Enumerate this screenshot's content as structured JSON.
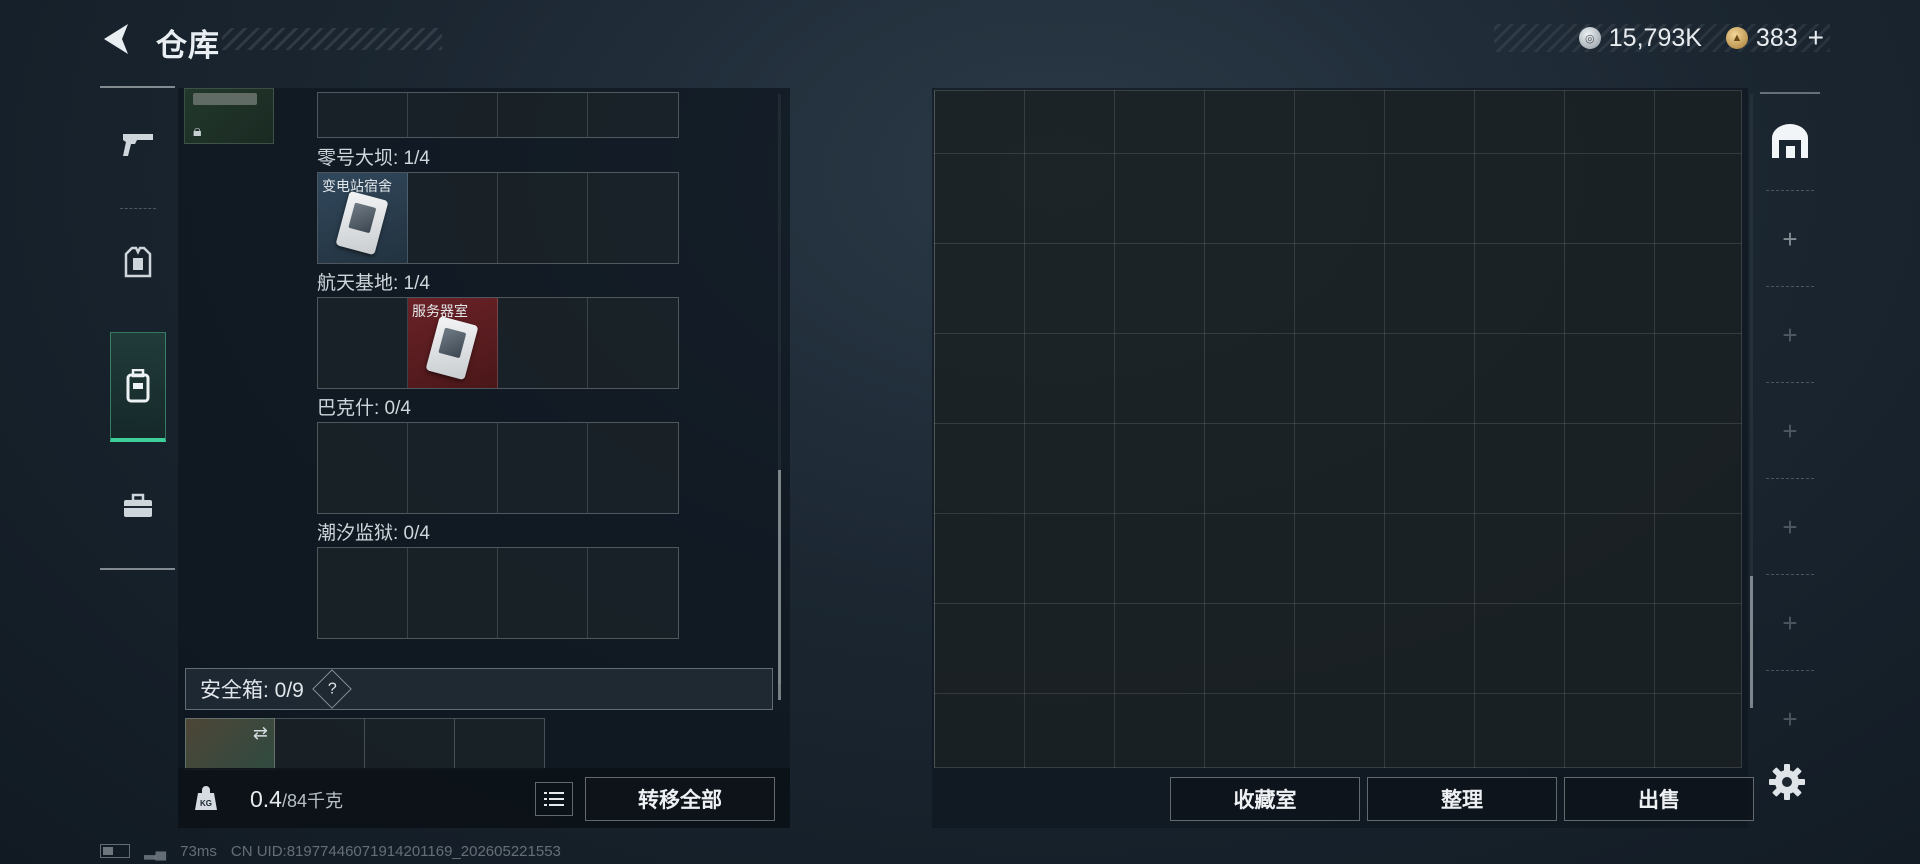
{
  "header": {
    "title": "仓库",
    "currency_silver": "15,793K",
    "currency_gold": "383",
    "add_label": "+"
  },
  "left_nav": {
    "items": [
      {
        "id": "weapons",
        "icon": "pistol-icon"
      },
      {
        "id": "armor",
        "icon": "vest-icon"
      },
      {
        "id": "backpack",
        "icon": "backpack-icon",
        "active": true
      },
      {
        "id": "toolbox",
        "icon": "toolbox-icon"
      }
    ]
  },
  "key_sections": [
    {
      "label": "零号大坝: 1/4",
      "slots": [
        {
          "item": "变电站宿舍",
          "color": "blue"
        },
        null,
        null,
        null
      ]
    },
    {
      "label": "航天基地: 1/4",
      "slots": [
        null,
        {
          "item": "服务器室",
          "color": "red"
        },
        null,
        null
      ]
    },
    {
      "label": "巴克什: 0/4",
      "slots": [
        null,
        null,
        null,
        null
      ]
    },
    {
      "label": "潮汐监狱: 0/4",
      "slots": [
        null,
        null,
        null,
        null
      ]
    }
  ],
  "safebox": {
    "label": "安全箱: 0/9",
    "help": "?"
  },
  "carry": {
    "weight_current": "0.4",
    "weight_max": "/84千克",
    "weight_icon_label": "KG"
  },
  "buttons": {
    "transfer_all": "转移全部",
    "collection": "收藏室",
    "sort": "整理",
    "sell": "出售"
  },
  "status": {
    "ping": "73ms",
    "uid": "CN UID:819774460719142011​69_202605221553"
  },
  "colors": {
    "accent_green": "#3fcf9a",
    "key_blue": "#31485c",
    "key_red": "#6a2227"
  }
}
